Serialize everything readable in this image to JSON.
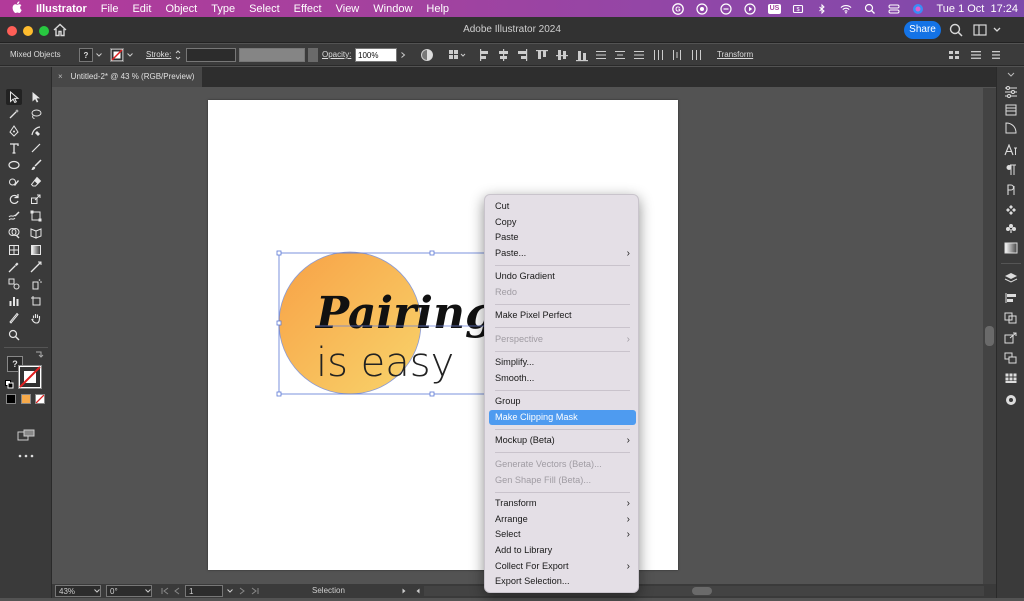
{
  "menubar": {
    "app": "Illustrator",
    "items": [
      "File",
      "Edit",
      "Object",
      "Type",
      "Select",
      "Effect",
      "View",
      "Window",
      "Help"
    ],
    "badge": "US",
    "datetime": "Tue 1 Oct  17:24"
  },
  "window": {
    "title": "Adobe Illustrator 2024",
    "share_label": "Share"
  },
  "control": {
    "selection_label": "Mixed Objects",
    "fill_label": "?",
    "stroke_label": "Stroke:",
    "opacity_label": "Opacity:",
    "opacity_value": "100%",
    "transform_label": "Transform"
  },
  "document": {
    "tab_close": "×",
    "tab_label": "Untitled-2* @ 43 % (RGB/Preview)"
  },
  "artwork": {
    "line1": "Pairing",
    "line2": "is easy",
    "gradient_start": "#f7a146",
    "gradient_end": "#f9d46b"
  },
  "statusbar": {
    "zoom": "43%",
    "rotation": "0°",
    "artboard_number": "1",
    "mode": "Selection"
  },
  "context_menu": {
    "cut": "Cut",
    "copy": "Copy",
    "paste": "Paste",
    "paste_more": "Paste...",
    "undo": "Undo Gradient",
    "redo": "Redo",
    "pixel_perfect": "Make Pixel Perfect",
    "perspective": "Perspective",
    "simplify": "Simplify...",
    "smooth": "Smooth...",
    "group": "Group",
    "clipping_mask": "Make Clipping Mask",
    "mockup": "Mockup (Beta)",
    "generate_vectors": "Generate Vectors (Beta)...",
    "gen_shape_fill": "Gen Shape Fill (Beta)...",
    "transform": "Transform",
    "arrange": "Arrange",
    "select": "Select",
    "add_to_library": "Add to Library",
    "collect_for_export": "Collect For Export",
    "export_selection": "Export Selection..."
  },
  "colors": {
    "menu_highlight": "#4e9bf0",
    "share_button": "#1473e6",
    "menubar_start": "#b23a9a",
    "menubar_end": "#7e4aab"
  }
}
